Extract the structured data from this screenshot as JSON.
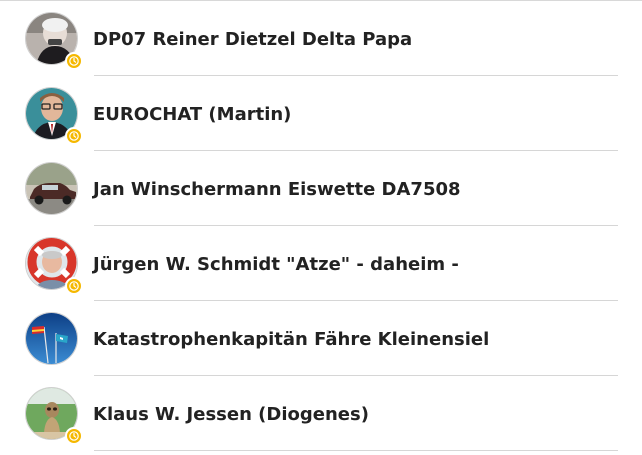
{
  "contacts": [
    {
      "name": "DP07 Reiner Dietzel Delta Papa",
      "avatar_icon": "person-photo-avatar",
      "badge_icon": "clock-icon",
      "has_badge": true
    },
    {
      "name": "EUROCHAT (Martin)",
      "avatar_icon": "person-photo-avatar",
      "badge_icon": "clock-icon",
      "has_badge": true
    },
    {
      "name": "Jan Winschermann Eiswette DA7508",
      "avatar_icon": "vintage-car-photo-avatar",
      "has_badge": false
    },
    {
      "name": "Jürgen W. Schmidt \"Atze\" - daheim -",
      "avatar_icon": "lifebuoy-photo-avatar",
      "badge_icon": "clock-icon",
      "has_badge": true
    },
    {
      "name": "Katastrophenkapitän Fähre Kleinensiel",
      "avatar_icon": "flags-sky-photo-avatar",
      "has_badge": false
    },
    {
      "name": "Klaus W. Jessen (Diogenes)",
      "avatar_icon": "meerkat-photo-avatar",
      "badge_icon": "clock-icon",
      "has_badge": true
    }
  ],
  "colors": {
    "badge": "#f5b800",
    "text": "#222222",
    "divider": "#d6d6d6"
  }
}
